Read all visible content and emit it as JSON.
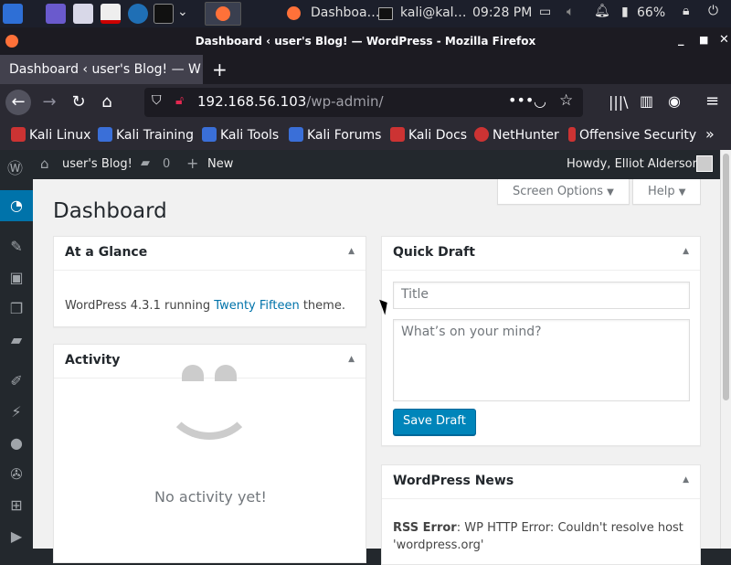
{
  "taskbar": {
    "firefox_task": "Dashboa…",
    "terminal_task": "kali@kal…",
    "clock": "09:28 PM",
    "battery": "66%"
  },
  "browser": {
    "window_title": "Dashboard ‹ user's Blog! — WordPress - Mozilla Firefox",
    "tab_label": "Dashboard ‹ user's Blog! — W",
    "url_host": "192.168.56.103",
    "url_path": "/wp-admin/",
    "bookmarks": [
      "Kali Linux",
      "Kali Training",
      "Kali Tools",
      "Kali Forums",
      "Kali Docs",
      "NetHunter",
      "Offensive Security"
    ]
  },
  "adminbar": {
    "site_name": "user's Blog!",
    "comment_count": "0",
    "new_label": "New",
    "greeting": "Howdy, Elliot Alderson"
  },
  "screen_meta": {
    "screen_options": "Screen Options",
    "help": "Help"
  },
  "page": {
    "title": "Dashboard"
  },
  "at_a_glance": {
    "title": "At a Glance",
    "text_before": "WordPress 4.3.1 running",
    "theme_link": "Twenty Fifteen",
    "text_after": "theme."
  },
  "activity": {
    "title": "Activity",
    "empty": "No activity yet!"
  },
  "quick_draft": {
    "title": "Quick Draft",
    "title_placeholder": "Title",
    "content_placeholder": "What’s on your mind?",
    "save_label": "Save Draft"
  },
  "news": {
    "title": "WordPress News",
    "error_label": "RSS Error",
    "error_text": ": WP HTTP Error: Couldn't resolve host",
    "error_host": "'wordpress.org'"
  },
  "colors": {
    "wp_blue": "#0073aa",
    "wp_dark": "#23282d",
    "button_blue": "#0085ba"
  }
}
